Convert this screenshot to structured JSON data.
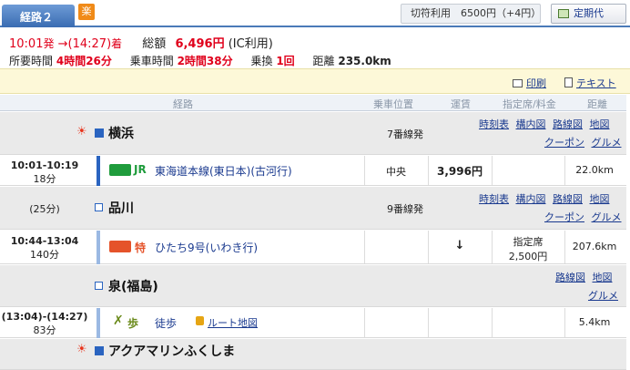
{
  "tab": {
    "label": "経路２",
    "badge": "楽"
  },
  "fare_info": "切符利用　6500円（+4円）",
  "commuter_label": "定期代",
  "summary": {
    "depart": "10:01",
    "depart_suffix": "発",
    "arrow": "→",
    "arrive": "(14:27)",
    "arrive_suffix": "着",
    "total_label": "総額",
    "total_value": "6,496円",
    "total_note": "(IC利用)",
    "duration_label": "所要時間",
    "duration_value": "4時間26分",
    "ride_label": "乗車時間",
    "ride_value": "2時間38分",
    "transfer_label": "乗換",
    "transfer_value": "1回",
    "distance_label": "距離",
    "distance_value": "235.0km"
  },
  "actions": {
    "print": "印刷",
    "text": "テキスト"
  },
  "header": {
    "route": "経路",
    "position": "乗車位置",
    "fare": "運賃",
    "reserved": "指定席/料金",
    "distance": "距離"
  },
  "stations": [
    {
      "name": "横浜",
      "track": "7番線発",
      "links": [
        "時刻表",
        "構内図",
        "路線図",
        "地図",
        "クーポン",
        "グルメ"
      ]
    },
    {
      "name": "品川",
      "wait": "(25分)",
      "track": "9番線発",
      "links": [
        "時刻表",
        "構内図",
        "路線図",
        "地図",
        "クーポン",
        "グルメ"
      ]
    },
    {
      "name": "泉(福島)",
      "links": [
        "路線図",
        "地図",
        "グルメ"
      ]
    },
    {
      "name": "アクアマリンふくしま"
    }
  ],
  "segments": [
    {
      "time": "10:01-10:19",
      "mins": "18分",
      "line": "東海道本線(東日本)(古河行)",
      "badge": "JR",
      "position": "中央",
      "fare": "3,996円",
      "reserved": "",
      "reserved_price": "",
      "distance": "22.0km",
      "color": "#1f9c3c"
    },
    {
      "time": "10:44-13:04",
      "mins": "140分",
      "line": "ひたち9号(いわき行)",
      "badge": "特",
      "position": "",
      "fare": "↓",
      "reserved": "指定席",
      "reserved_price": "2,500円",
      "distance": "207.6km",
      "color": "#e5532a"
    },
    {
      "time": "(13:04)-(14:27)",
      "mins": "83分",
      "line": "徒歩",
      "badge": "歩",
      "route_map": "ルート地図",
      "position": "",
      "fare": "",
      "reserved": "",
      "reserved_price": "",
      "distance": "5.4km",
      "color": "#6a8a1a"
    }
  ]
}
